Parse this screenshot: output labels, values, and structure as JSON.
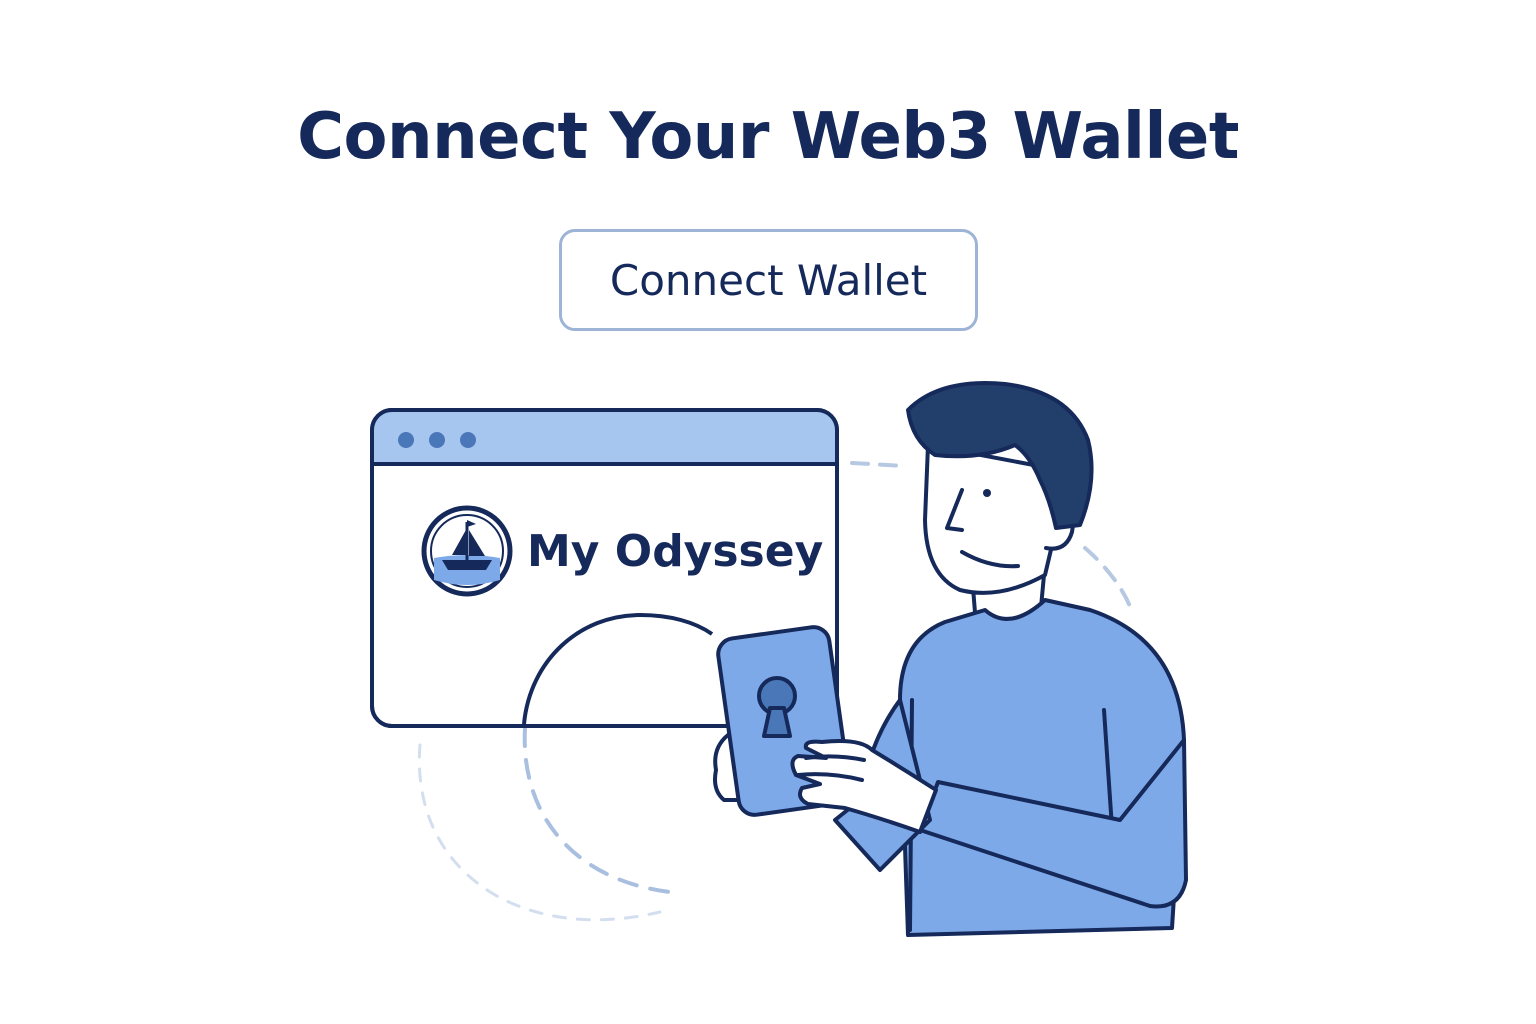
{
  "header": {
    "title": "Connect Your Web3 Wallet"
  },
  "actions": {
    "connect_label": "Connect Wallet"
  },
  "browser_window": {
    "brand_name": "My Odyssey",
    "dots": [
      "window-dot",
      "window-dot",
      "window-dot"
    ]
  },
  "colors": {
    "navy": "#15295a",
    "accent_blue": "#7ea9e8",
    "light_blue": "#a6c6ef",
    "border_blue": "#9db4d6",
    "dashed": "#b7c8e3"
  },
  "icons": [
    "ship-logo-icon",
    "keyhole-icon",
    "person-illustration"
  ]
}
